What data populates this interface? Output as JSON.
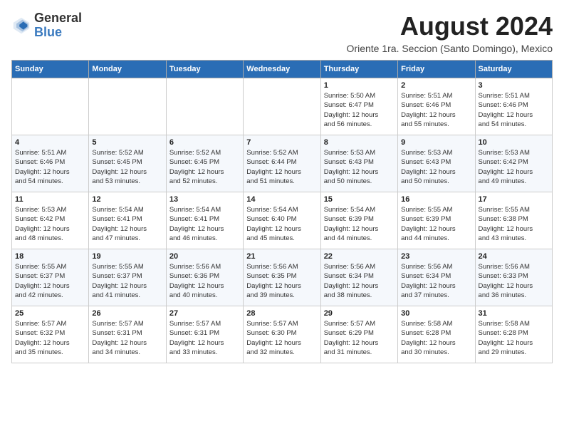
{
  "logo": {
    "general": "General",
    "blue": "Blue"
  },
  "title": "August 2024",
  "location": "Oriente 1ra. Seccion (Santo Domingo), Mexico",
  "days_of_week": [
    "Sunday",
    "Monday",
    "Tuesday",
    "Wednesday",
    "Thursday",
    "Friday",
    "Saturday"
  ],
  "weeks": [
    [
      {
        "day": "",
        "info": ""
      },
      {
        "day": "",
        "info": ""
      },
      {
        "day": "",
        "info": ""
      },
      {
        "day": "",
        "info": ""
      },
      {
        "day": "1",
        "info": "Sunrise: 5:50 AM\nSunset: 6:47 PM\nDaylight: 12 hours\nand 56 minutes."
      },
      {
        "day": "2",
        "info": "Sunrise: 5:51 AM\nSunset: 6:46 PM\nDaylight: 12 hours\nand 55 minutes."
      },
      {
        "day": "3",
        "info": "Sunrise: 5:51 AM\nSunset: 6:46 PM\nDaylight: 12 hours\nand 54 minutes."
      }
    ],
    [
      {
        "day": "4",
        "info": "Sunrise: 5:51 AM\nSunset: 6:46 PM\nDaylight: 12 hours\nand 54 minutes."
      },
      {
        "day": "5",
        "info": "Sunrise: 5:52 AM\nSunset: 6:45 PM\nDaylight: 12 hours\nand 53 minutes."
      },
      {
        "day": "6",
        "info": "Sunrise: 5:52 AM\nSunset: 6:45 PM\nDaylight: 12 hours\nand 52 minutes."
      },
      {
        "day": "7",
        "info": "Sunrise: 5:52 AM\nSunset: 6:44 PM\nDaylight: 12 hours\nand 51 minutes."
      },
      {
        "day": "8",
        "info": "Sunrise: 5:53 AM\nSunset: 6:43 PM\nDaylight: 12 hours\nand 50 minutes."
      },
      {
        "day": "9",
        "info": "Sunrise: 5:53 AM\nSunset: 6:43 PM\nDaylight: 12 hours\nand 50 minutes."
      },
      {
        "day": "10",
        "info": "Sunrise: 5:53 AM\nSunset: 6:42 PM\nDaylight: 12 hours\nand 49 minutes."
      }
    ],
    [
      {
        "day": "11",
        "info": "Sunrise: 5:53 AM\nSunset: 6:42 PM\nDaylight: 12 hours\nand 48 minutes."
      },
      {
        "day": "12",
        "info": "Sunrise: 5:54 AM\nSunset: 6:41 PM\nDaylight: 12 hours\nand 47 minutes."
      },
      {
        "day": "13",
        "info": "Sunrise: 5:54 AM\nSunset: 6:41 PM\nDaylight: 12 hours\nand 46 minutes."
      },
      {
        "day": "14",
        "info": "Sunrise: 5:54 AM\nSunset: 6:40 PM\nDaylight: 12 hours\nand 45 minutes."
      },
      {
        "day": "15",
        "info": "Sunrise: 5:54 AM\nSunset: 6:39 PM\nDaylight: 12 hours\nand 44 minutes."
      },
      {
        "day": "16",
        "info": "Sunrise: 5:55 AM\nSunset: 6:39 PM\nDaylight: 12 hours\nand 44 minutes."
      },
      {
        "day": "17",
        "info": "Sunrise: 5:55 AM\nSunset: 6:38 PM\nDaylight: 12 hours\nand 43 minutes."
      }
    ],
    [
      {
        "day": "18",
        "info": "Sunrise: 5:55 AM\nSunset: 6:37 PM\nDaylight: 12 hours\nand 42 minutes."
      },
      {
        "day": "19",
        "info": "Sunrise: 5:55 AM\nSunset: 6:37 PM\nDaylight: 12 hours\nand 41 minutes."
      },
      {
        "day": "20",
        "info": "Sunrise: 5:56 AM\nSunset: 6:36 PM\nDaylight: 12 hours\nand 40 minutes."
      },
      {
        "day": "21",
        "info": "Sunrise: 5:56 AM\nSunset: 6:35 PM\nDaylight: 12 hours\nand 39 minutes."
      },
      {
        "day": "22",
        "info": "Sunrise: 5:56 AM\nSunset: 6:34 PM\nDaylight: 12 hours\nand 38 minutes."
      },
      {
        "day": "23",
        "info": "Sunrise: 5:56 AM\nSunset: 6:34 PM\nDaylight: 12 hours\nand 37 minutes."
      },
      {
        "day": "24",
        "info": "Sunrise: 5:56 AM\nSunset: 6:33 PM\nDaylight: 12 hours\nand 36 minutes."
      }
    ],
    [
      {
        "day": "25",
        "info": "Sunrise: 5:57 AM\nSunset: 6:32 PM\nDaylight: 12 hours\nand 35 minutes."
      },
      {
        "day": "26",
        "info": "Sunrise: 5:57 AM\nSunset: 6:31 PM\nDaylight: 12 hours\nand 34 minutes."
      },
      {
        "day": "27",
        "info": "Sunrise: 5:57 AM\nSunset: 6:31 PM\nDaylight: 12 hours\nand 33 minutes."
      },
      {
        "day": "28",
        "info": "Sunrise: 5:57 AM\nSunset: 6:30 PM\nDaylight: 12 hours\nand 32 minutes."
      },
      {
        "day": "29",
        "info": "Sunrise: 5:57 AM\nSunset: 6:29 PM\nDaylight: 12 hours\nand 31 minutes."
      },
      {
        "day": "30",
        "info": "Sunrise: 5:58 AM\nSunset: 6:28 PM\nDaylight: 12 hours\nand 30 minutes."
      },
      {
        "day": "31",
        "info": "Sunrise: 5:58 AM\nSunset: 6:28 PM\nDaylight: 12 hours\nand 29 minutes."
      }
    ]
  ]
}
